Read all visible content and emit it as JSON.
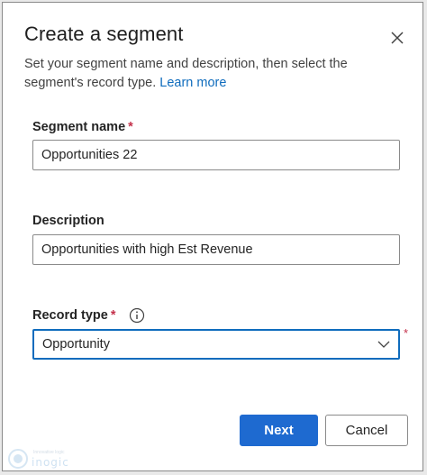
{
  "dialog": {
    "title": "Create a segment",
    "subtitle": "Set your segment name and description, then select the segment's record type.",
    "learn_more": "Learn more",
    "close_icon": "close-icon"
  },
  "fields": {
    "segment_name": {
      "label": "Segment name",
      "required_mark": "*",
      "value": "Opportunities 22"
    },
    "description": {
      "label": "Description",
      "value": "Opportunities with high Est Revenue"
    },
    "record_type": {
      "label": "Record type",
      "required_mark": "*",
      "info_icon": "info-icon",
      "selected": "Opportunity",
      "side_required_mark": "*"
    }
  },
  "buttons": {
    "next": "Next",
    "cancel": "Cancel"
  },
  "watermark": {
    "logo_text": "inogic",
    "tagline": "Innovative logic"
  },
  "colors": {
    "primary": "#1e6ad0",
    "link": "#0f6cbd",
    "required": "#c4314b",
    "focus_border": "#0f6cbd"
  }
}
